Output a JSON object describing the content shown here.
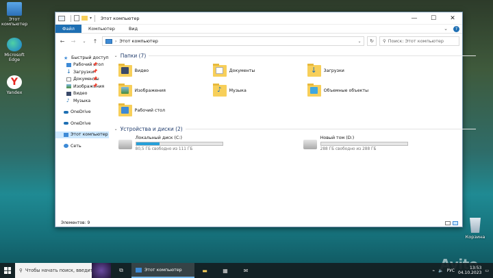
{
  "desktop": {
    "icons": [
      {
        "label": "Этот компьютер",
        "icon": "computer-icon"
      },
      {
        "label": "Microsoft Edge",
        "icon": "edge-icon"
      },
      {
        "label": "Yandex",
        "icon": "yandex-icon"
      }
    ],
    "recycle_bin": "Корзина"
  },
  "window": {
    "title": "Этот компьютер",
    "controls": {
      "minimize": "—",
      "maximize": "☐",
      "close": "✕"
    },
    "ribbon_tabs": [
      "Файл",
      "Компьютер",
      "Вид"
    ],
    "help": "?",
    "address": "Этот компьютер",
    "search_placeholder": "Поиск: Этот компьютер",
    "status": "Элементов: 9"
  },
  "nav": {
    "quick_access": "Быстрый доступ",
    "items": [
      {
        "label": "Рабочий стол",
        "pinned": true
      },
      {
        "label": "Загрузки",
        "pinned": true
      },
      {
        "label": "Документы",
        "pinned": true
      },
      {
        "label": "Изображения",
        "pinned": true
      },
      {
        "label": "Видео",
        "pinned": false
      },
      {
        "label": "Музыка",
        "pinned": false
      }
    ],
    "onedrive1": "OneDrive",
    "onedrive2": "OneDrive",
    "this_pc": "Этот компьютер",
    "network": "Сеть"
  },
  "folders_group": "Папки (7)",
  "folders": [
    {
      "label": "Видео",
      "icon": "video-folder-icon"
    },
    {
      "label": "Документы",
      "icon": "documents-folder-icon"
    },
    {
      "label": "Загрузки",
      "icon": "downloads-folder-icon"
    },
    {
      "label": "Изображения",
      "icon": "pictures-folder-icon"
    },
    {
      "label": "Музыка",
      "icon": "music-folder-icon"
    },
    {
      "label": "Объемные объекты",
      "icon": "3d-objects-folder-icon"
    },
    {
      "label": "Рабочий стол",
      "icon": "desktop-folder-icon"
    }
  ],
  "drives_group": "Устройства и диски (2)",
  "drives": [
    {
      "name": "Локальный диск (C:)",
      "free": "80,5 ГБ свободно из 111 ГБ",
      "used_fraction": 0.275
    },
    {
      "name": "Новый том (D:)",
      "free": "288 ГБ свободно из 288 ГБ",
      "used_fraction": 0.0
    }
  ],
  "taskbar": {
    "search_text": "Чтобы начать поиск, введите",
    "active_app": "Этот компьютер",
    "lang": "РУС",
    "time": "13:53",
    "date": "04.10.2023"
  },
  "watermark": "Avito",
  "colors": {
    "accent": "#1e6fb3",
    "selection": "#cce8ff",
    "drive_fill": "#26a0da"
  }
}
